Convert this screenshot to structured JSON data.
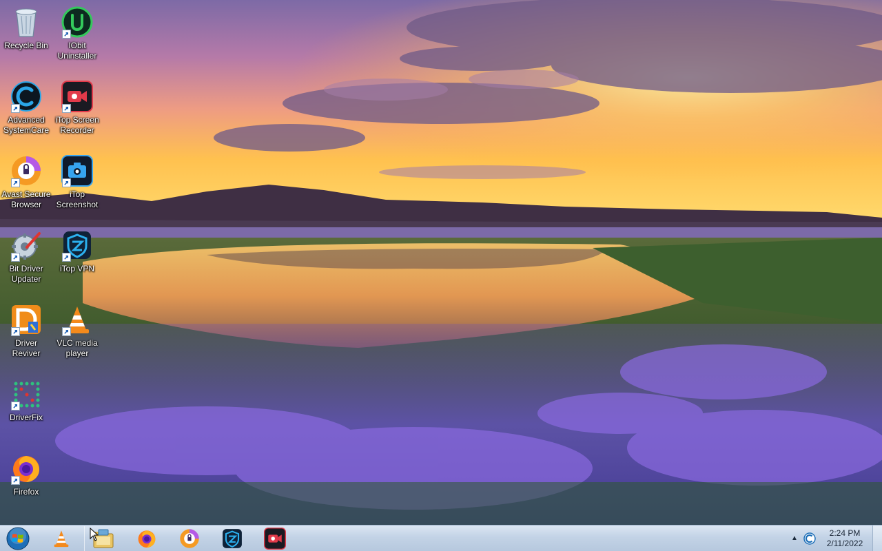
{
  "desktop": {
    "icons": [
      {
        "id": "recycle-bin",
        "label": "Recycle Bin",
        "icon": "recycle-bin-icon",
        "shortcut": false
      },
      {
        "id": "iobit-uninstaller",
        "label": "IObit\nUninstaller",
        "icon": "iobit-uninstaller-icon",
        "shortcut": true
      },
      {
        "id": "advanced-systemcare",
        "label": "Advanced\nSystemCare",
        "icon": "advanced-systemcare-icon",
        "shortcut": true
      },
      {
        "id": "itop-screen-recorder",
        "label": "iTop Screen\nRecorder",
        "icon": "itop-screen-recorder-icon",
        "shortcut": true
      },
      {
        "id": "avast-secure-browser",
        "label": "Avast Secure\nBrowser",
        "icon": "avast-secure-browser-icon",
        "shortcut": true
      },
      {
        "id": "itop-screenshot",
        "label": "iTop\nScreenshot",
        "icon": "itop-screenshot-icon",
        "shortcut": true
      },
      {
        "id": "bit-driver-updater",
        "label": "Bit Driver\nUpdater",
        "icon": "bit-driver-updater-icon",
        "shortcut": true
      },
      {
        "id": "itop-vpn",
        "label": "iTop VPN",
        "icon": "itop-vpn-icon",
        "shortcut": true
      },
      {
        "id": "driver-reviver",
        "label": "Driver\nReviver",
        "icon": "driver-reviver-icon",
        "shortcut": true
      },
      {
        "id": "vlc-media-player",
        "label": "VLC media\nplayer",
        "icon": "vlc-icon",
        "shortcut": true
      },
      {
        "id": "driverfix",
        "label": "DriverFix",
        "icon": "driverfix-icon",
        "shortcut": true
      },
      {
        "id": "firefox",
        "label": "Firefox",
        "icon": "firefox-icon",
        "shortcut": true
      }
    ]
  },
  "taskbar": {
    "start_icon": "windows-start-orb-icon",
    "items": [
      {
        "id": "vlc",
        "icon": "vlc-icon"
      },
      {
        "id": "file-explorer",
        "icon": "file-explorer-icon"
      },
      {
        "id": "firefox",
        "icon": "firefox-icon"
      },
      {
        "id": "avast-secure-browser",
        "icon": "avast-secure-browser-icon"
      },
      {
        "id": "itop-vpn",
        "icon": "itop-vpn-icon"
      },
      {
        "id": "itop-screen-recorder",
        "icon": "itop-screen-recorder-icon"
      }
    ],
    "tray": {
      "overflow_icon": "chevron-up-icon",
      "app_icon": "ccleaner-icon",
      "time": "2:24 PM",
      "date": "2/11/2022"
    }
  },
  "colors": {
    "taskbar": "#c3d3e6",
    "label_text": "#ffffff",
    "sky_top": "#7e6aa8",
    "sunset": "#ffc94a",
    "flowers": "#6b52c8"
  }
}
